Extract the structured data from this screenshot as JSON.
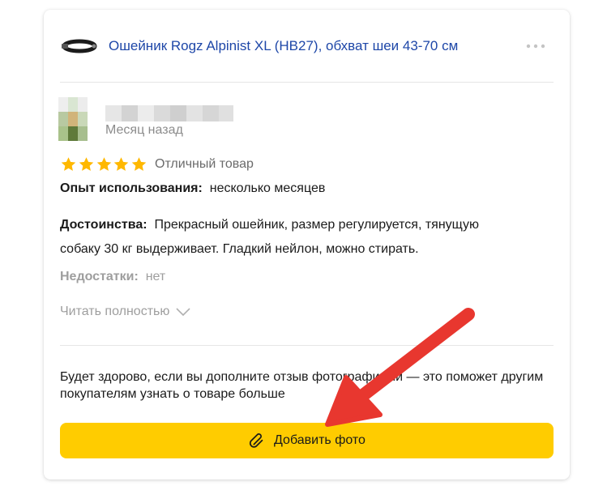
{
  "review": {
    "product_title": "Ошейник Rogz Alpinist XL (HB27), обхват шеи 43-70 см",
    "date": "Месяц назад",
    "rating": 5,
    "rating_text": "Отличный товар",
    "usage_label": "Опыт использования:",
    "usage_value": "несколько месяцев",
    "pros_label": "Достоинства:",
    "pros_value": "Прекрасный ошейник, размер регулируется, тянущую собаку 30 кг выдерживает. Гладкий нейлон, можно стирать.",
    "cons_label": "Недостатки:",
    "cons_value": "нет",
    "read_more": "Читать полностью"
  },
  "photo_prompt": {
    "text": "Будет здорово, если вы дополните отзыв фотографиями — это поможет другим покупателям узнать о товаре больше",
    "button_label": "Добавить фото"
  },
  "icons": [
    "collar-icon",
    "more-icon",
    "star-icon",
    "chevron-down-icon",
    "paperclip-icon",
    "arrow-annotation"
  ],
  "colors": {
    "link": "#1e47a8",
    "star": "#ffb800",
    "button": "#ffcc00",
    "arrow": "#e8372f"
  }
}
